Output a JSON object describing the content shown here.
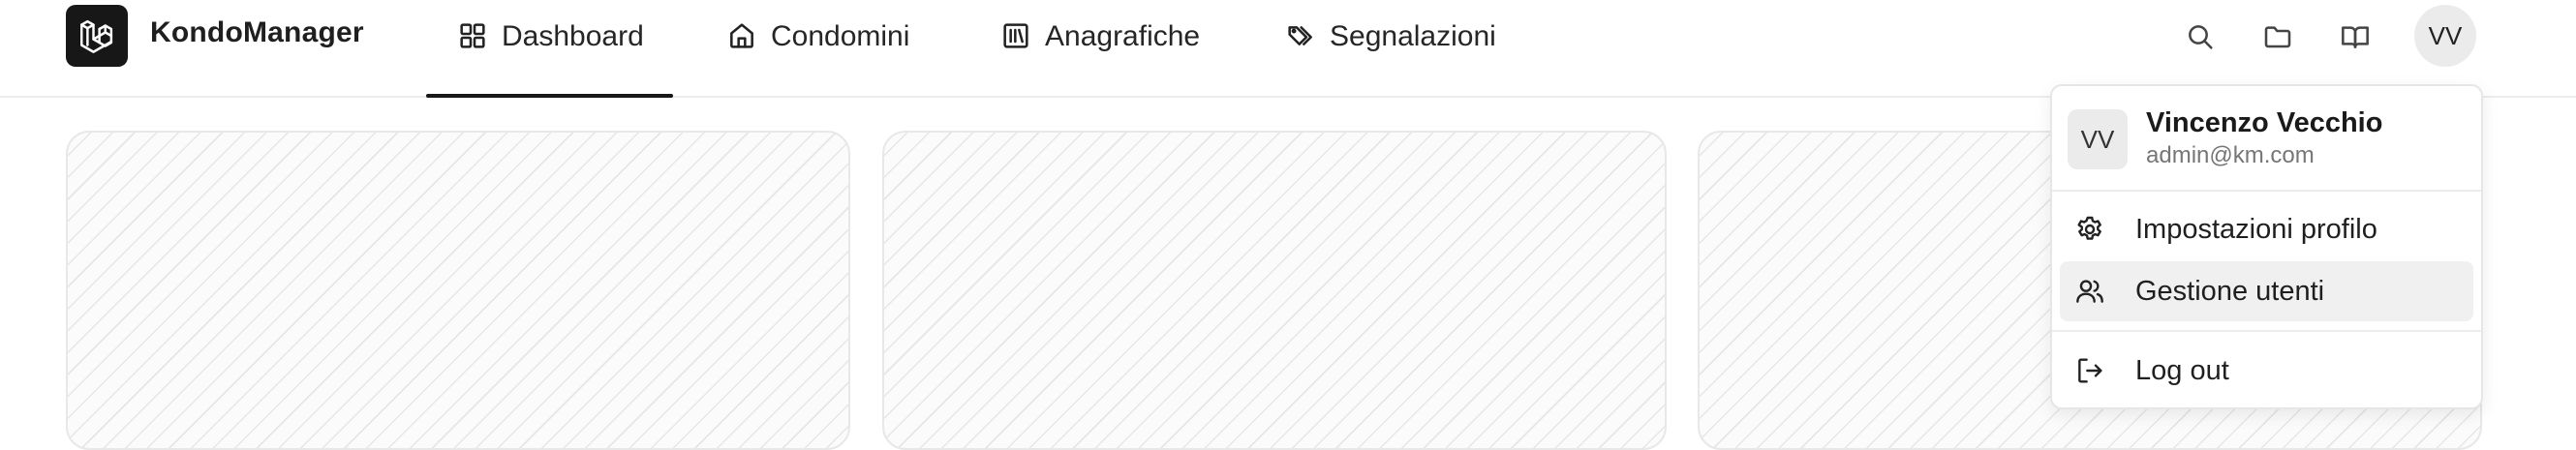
{
  "app": {
    "title": "KondoManager",
    "logo_icon": "laravel-logo-icon"
  },
  "nav": {
    "active": "Dashboard",
    "items": [
      {
        "label": "Dashboard",
        "icon": "grid-icon"
      },
      {
        "label": "Condomini",
        "icon": "home-icon"
      },
      {
        "label": "Anagrafiche",
        "icon": "library-icon"
      },
      {
        "label": "Segnalazioni",
        "icon": "tags-icon"
      }
    ]
  },
  "toolbar": {
    "icons": [
      "search-icon",
      "folder-icon",
      "book-open-icon"
    ],
    "avatar_initials": "VV"
  },
  "user_menu": {
    "avatar_initials": "VV",
    "name": "Vincenzo Vecchio",
    "email": "admin@km.com",
    "items": [
      {
        "label": "Impostazioni profilo",
        "icon": "gear-icon"
      },
      {
        "label": "Gestione utenti",
        "icon": "users-icon",
        "highlighted": true
      },
      {
        "label": "Log out",
        "icon": "log-out-icon"
      }
    ]
  },
  "colors": {
    "text": "#171717",
    "accent": "#171717",
    "muted": "#767676",
    "border": "#e6e6e6"
  }
}
